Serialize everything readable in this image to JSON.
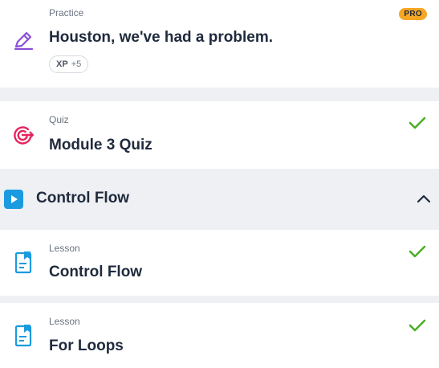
{
  "items": [
    {
      "kicker": "Practice",
      "title": "Houston, we've had a problem.",
      "badge": "PRO",
      "xp_label": "XP",
      "xp_value": "+5",
      "icon": "pencil-icon"
    },
    {
      "kicker": "Quiz",
      "title": "Module 3 Quiz",
      "completed": true,
      "icon": "target-icon"
    }
  ],
  "section": {
    "title": "Control Flow",
    "icon": "play-icon",
    "toggle_icon": "chevron-up-icon",
    "expanded": true
  },
  "section_items": [
    {
      "kicker": "Lesson",
      "title": "Control Flow",
      "completed": true,
      "icon": "lesson-document-icon"
    },
    {
      "kicker": "Lesson",
      "title": "For Loops",
      "completed": true,
      "icon": "lesson-document-icon"
    }
  ],
  "colors": {
    "accent_purple": "#8a4fd8",
    "quiz_pink": "#e5245f",
    "lesson_blue": "#1a9be0",
    "check_green": "#4caf26",
    "pro_orange": "#f5a623"
  }
}
